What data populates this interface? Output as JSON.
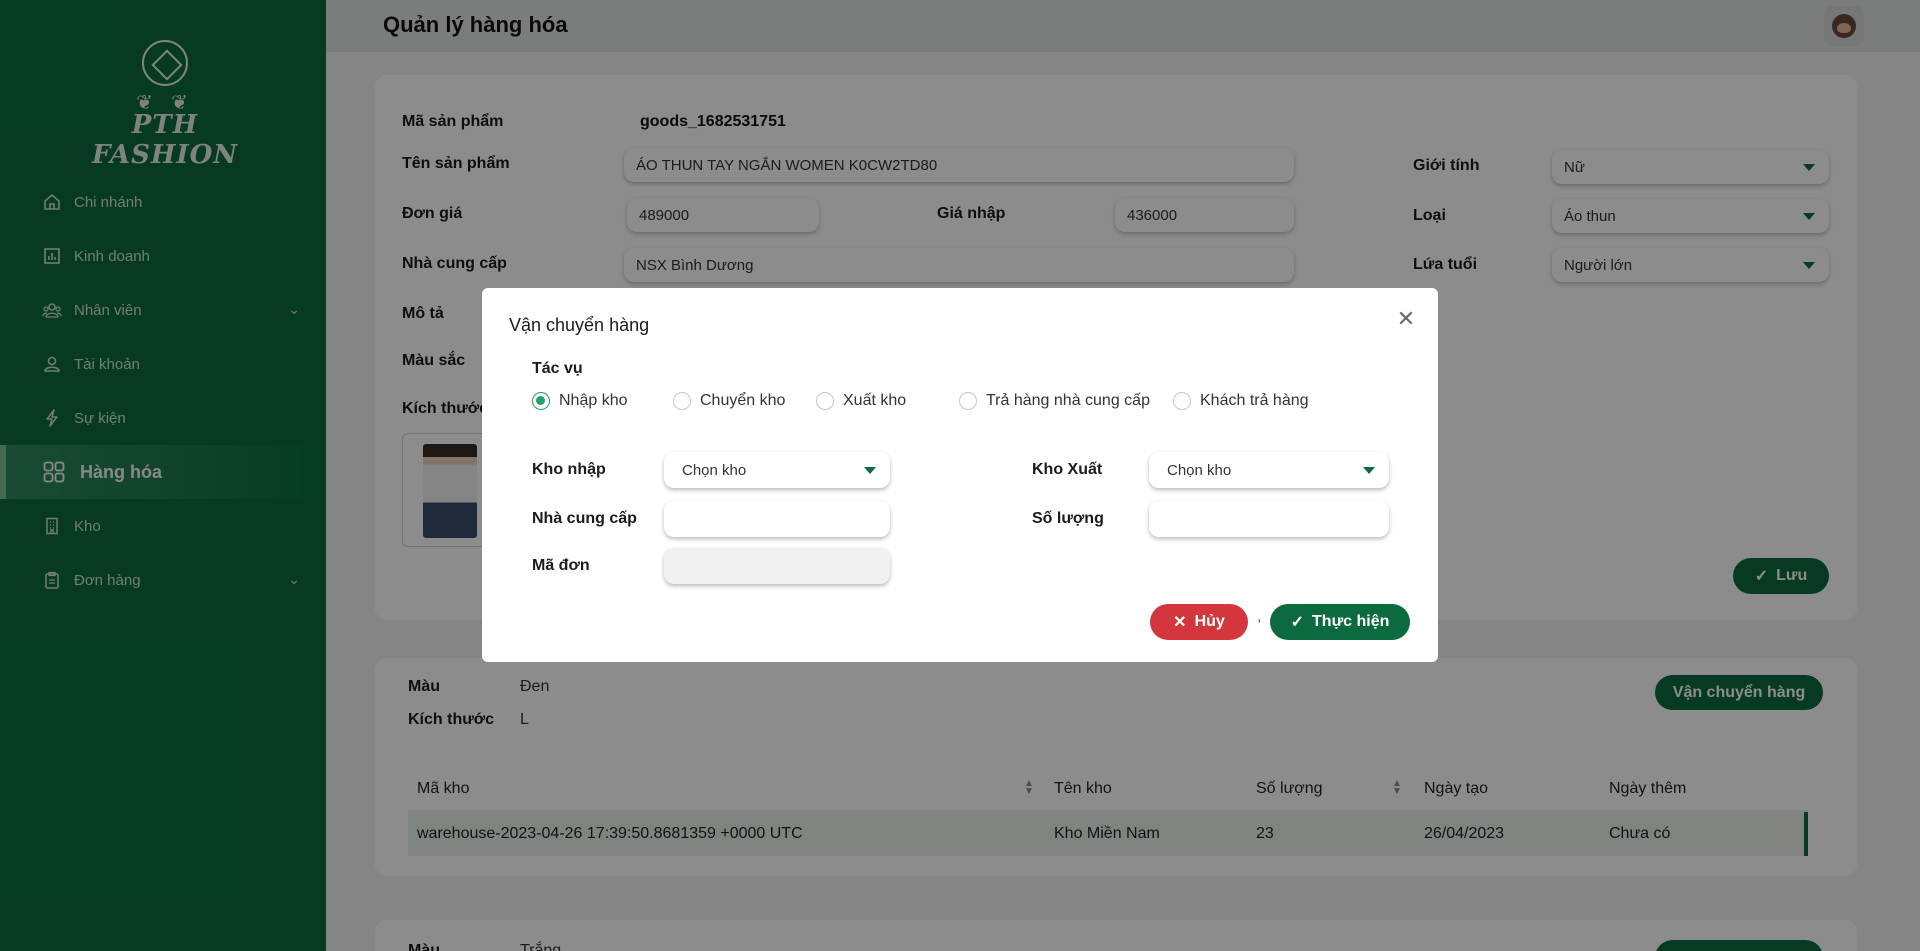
{
  "brand": {
    "name": "PTH FASHION",
    "ornament": "❦ ❦"
  },
  "header": {
    "title": "Quản lý hàng hóa"
  },
  "sidebar": {
    "items": [
      {
        "label": "Chi nhánh"
      },
      {
        "label": "Kinh doanh"
      },
      {
        "label": "Nhân viên"
      },
      {
        "label": "Tài khoản"
      },
      {
        "label": "Sự kiện"
      },
      {
        "label": "Hàng hóa"
      },
      {
        "label": "Kho"
      },
      {
        "label": "Đơn hàng"
      }
    ]
  },
  "product": {
    "code_label": "Mã sản phẩm",
    "code_value": "goods_1682531751",
    "name_label": "Tên sản phẩm",
    "name_value": "ÁO THUN TAY NGẮN WOMEN K0CW2TD80",
    "price_label": "Đơn giá",
    "price_value": "489000",
    "import_price_label": "Giá nhập",
    "import_price_value": "436000",
    "supplier_label": "Nhà cung cấp",
    "supplier_value": "NSX Bình Dương",
    "description_label": "Mô tả",
    "color_label": "Màu sắc",
    "size_label": "Kích thước",
    "gender_label": "Giới tính",
    "gender_value": "Nữ",
    "type_label": "Loại",
    "type_value": "Áo thun",
    "age_label": "Lứa tuổi",
    "age_value": "Người lớn",
    "save_label": "Lưu"
  },
  "variant": {
    "color_label": "Màu",
    "color_value": "Đen",
    "size_label": "Kích thước",
    "size_value": "L",
    "transfer_button": "Vận chuyển hàng",
    "columns": [
      "Mã kho",
      "Tên kho",
      "Số lượng",
      "Ngày tạo",
      "Ngày thêm"
    ],
    "rows": [
      [
        "warehouse-2023-04-26 17:39:50.8681359 +0000 UTC",
        "Kho Miền Nam",
        "23",
        "26/04/2023",
        "Chưa có"
      ]
    ]
  },
  "variant2": {
    "color_label": "Màu",
    "color_value": "Trắng"
  },
  "modal": {
    "title": "Vận chuyển hàng",
    "task_label": "Tác vụ",
    "options": [
      "Nhập kho",
      "Chuyển kho",
      "Xuất kho",
      "Trả hàng nhà cung cấp",
      "Khách trả hàng"
    ],
    "selected": "Nhập kho",
    "import_wh_label": "Kho nhập",
    "import_wh_value": "Chọn kho",
    "export_wh_label": "Kho Xuất",
    "export_wh_value": "Chọn kho",
    "supplier_label": "Nhà cung cấp",
    "supplier_value": "",
    "quantity_label": "Số lượng",
    "quantity_value": "",
    "order_label": "Mã đơn",
    "order_value": "",
    "cancel_label": "Hủy",
    "separator": ",",
    "execute_label": "Thực hiện"
  },
  "colors": {
    "primary": "#0b6b3f",
    "danger": "#d3373d",
    "radio": "#22a36a"
  }
}
